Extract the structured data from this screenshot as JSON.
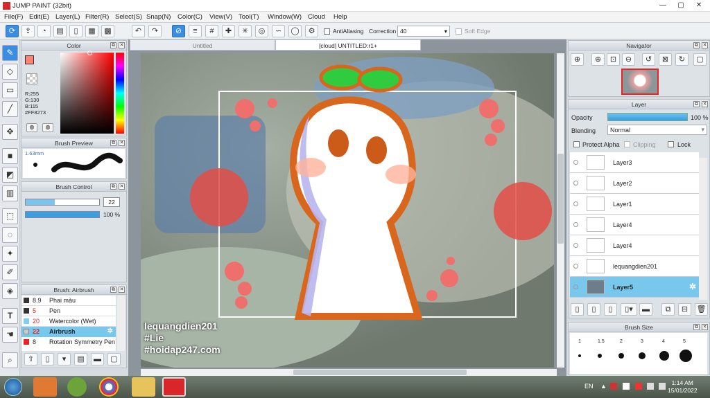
{
  "window": {
    "title": "JUMP PAINT (32bit)",
    "minimize": "—",
    "maximize": "▢",
    "close": "✕"
  },
  "menu": [
    "File(F)",
    "Edit(E)",
    "Layer(L)",
    "Filter(R)",
    "Select(S)",
    "Snap(N)",
    "Color(C)",
    "View(V)",
    "Tool(T)",
    "Window(W)",
    "Cloud",
    "Help"
  ],
  "toolbar": {
    "antialias_label": "AntiAliasing",
    "correction_label": "Correction",
    "correction_value": "40",
    "softedge_label": "Soft Edge"
  },
  "color_panel": {
    "title": "Color",
    "r": "R:255",
    "g": "G:130",
    "b": "B:115",
    "hex": "#FF8273",
    "current": "#ff8273"
  },
  "brush_preview": {
    "title": "Brush Preview",
    "size": "1.63mm"
  },
  "brush_control": {
    "title": "Brush Control",
    "size_value": "22",
    "opacity_value": "100 %",
    "size_fraction": 0.4,
    "opacity_fraction": 1.0
  },
  "brush_list": {
    "title": "Brush: Airbrush",
    "items": [
      {
        "size": "8.9",
        "name": "Phai màu",
        "color": "#333333"
      },
      {
        "size": "5",
        "name": "Pen",
        "color": "#333333"
      },
      {
        "size": "20",
        "name": "Watercolor (Wet)",
        "color": "#7fd0ee"
      },
      {
        "size": "22",
        "name": "Airbrush",
        "color": "#cccccc"
      },
      {
        "size": "8",
        "name": "Rotation Symmetry Pen",
        "color": "#e22"
      }
    ]
  },
  "tabs": {
    "tab1": "Untitled",
    "tab2": "[cloud] UNTITLED:r1+"
  },
  "canvas": {
    "caption1": "lequangdien201",
    "caption2": "#Lie",
    "caption3": "#hoidap247.com"
  },
  "navigator": {
    "title": "Navigator"
  },
  "layer_panel": {
    "title": "Layer",
    "opacity_label": "Opacity",
    "opacity_value": "100 %",
    "blending_label": "Blending",
    "blending_value": "Normal",
    "protect_alpha": "Protect Alpha",
    "clipping": "Clipping",
    "lock": "Lock",
    "layers": [
      "Layer3",
      "Layer2",
      "Layer1",
      "Layer4",
      "Layer4",
      "lequangdien201",
      "Layer5"
    ]
  },
  "brush_size": {
    "title": "Brush Size",
    "sizes": [
      "1",
      "1.5",
      "2",
      "3",
      "4",
      "5"
    ]
  },
  "taskbar": {
    "lang": "EN",
    "time": "1:14 AM",
    "date": "15/01/2022"
  }
}
